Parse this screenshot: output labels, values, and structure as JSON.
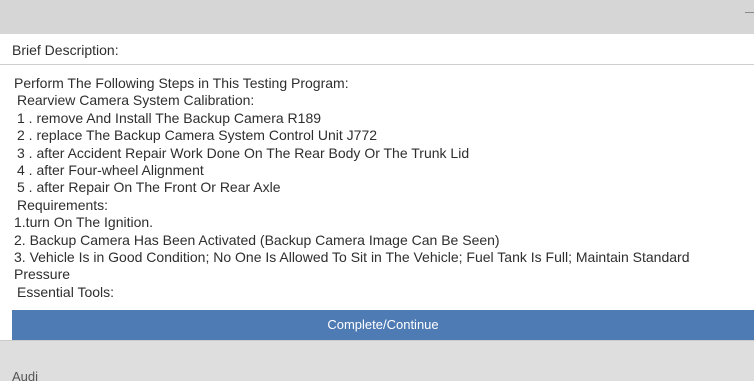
{
  "header": {
    "collapse_glyph": "–"
  },
  "brief": {
    "label": "Brief Description:"
  },
  "description": {
    "lines": [
      "Perform The Following Steps in This Testing Program:",
      "Rearview Camera System Calibration:",
      "1 . remove And Install The Backup Camera R189",
      "2 . replace The Backup Camera System Control Unit J772",
      "3 . after Accident Repair Work Done On The Rear Body Or The Trunk Lid",
      "4 . after Four-wheel Alignment",
      "5 . after Repair On The Front Or Rear Axle",
      "Requirements:",
      "1.turn On The Ignition.",
      "2. Backup Camera Has Been Activated (Backup Camera Image Can Be Seen)",
      "3. Vehicle Is in Good Condition; No One Is Allowed To Sit in The Vehicle; Fuel Tank Is Full; Maintain Standard",
      "Pressure",
      "Essential Tools:"
    ]
  },
  "action": {
    "label": "Complete/Continue",
    "color": "#4f7bb5"
  },
  "footer": {
    "brand": "Audi"
  }
}
